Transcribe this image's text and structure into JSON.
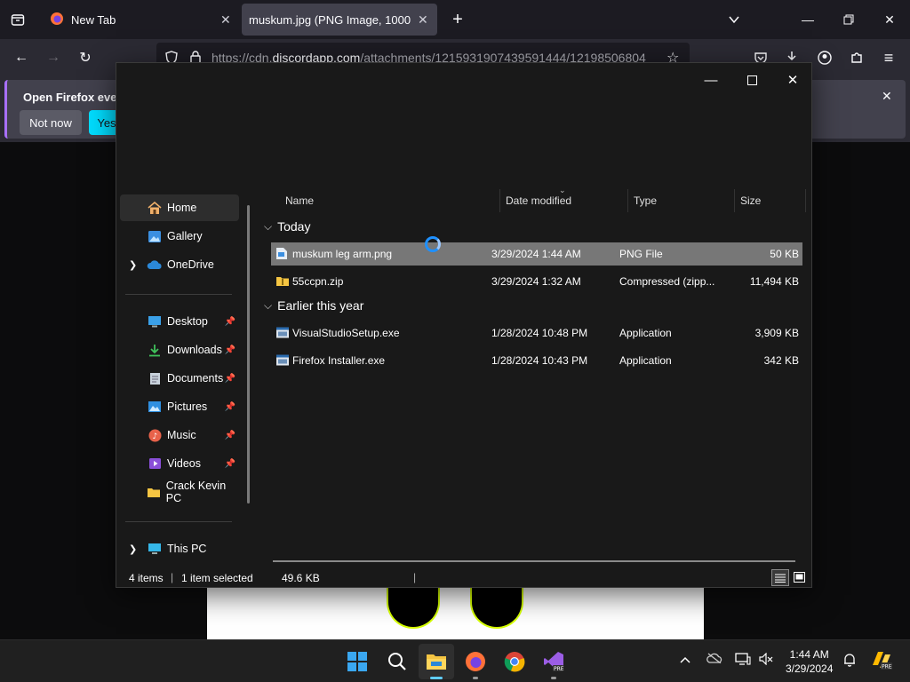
{
  "browser": {
    "tabs": [
      {
        "title": "New Tab",
        "active": false
      },
      {
        "title": "muskum.jpg (PNG Image, 1000 × 10",
        "active": true
      }
    ],
    "url_prefix": "https://cdn.",
    "url_domain": "discordapp.com",
    "url_rest": "/attachments/1215931907439591444/12198506804",
    "notification": {
      "title": "Open Firefox every",
      "not_now": "Not now",
      "yes": "Yes"
    }
  },
  "dialog": {
    "sidebar": {
      "items": [
        {
          "label": "Home",
          "icon": "home-icon",
          "selected": true
        },
        {
          "label": "Gallery",
          "icon": "gallery-icon"
        },
        {
          "label": "OneDrive",
          "icon": "onedrive-icon"
        },
        {
          "label": "Desktop",
          "icon": "desktop-icon",
          "pinned": true
        },
        {
          "label": "Downloads",
          "icon": "downloads-icon",
          "pinned": true
        },
        {
          "label": "Documents",
          "icon": "documents-icon",
          "pinned": true
        },
        {
          "label": "Pictures",
          "icon": "pictures-icon",
          "pinned": true
        },
        {
          "label": "Music",
          "icon": "music-icon",
          "pinned": true
        },
        {
          "label": "Videos",
          "icon": "videos-icon",
          "pinned": true
        },
        {
          "label": "Crack Kevin PC",
          "icon": "folder-icon"
        },
        {
          "label": "This PC",
          "icon": "this-pc-icon"
        }
      ]
    },
    "columns": {
      "name": "Name",
      "date": "Date modified",
      "type": "Type",
      "size": "Size"
    },
    "groups": [
      {
        "label": "Today",
        "files": [
          {
            "name": "muskum leg arm.png",
            "date": "3/29/2024 1:44 AM",
            "type": "PNG File",
            "size": "50 KB",
            "selected": true,
            "icon": "png-file-icon"
          },
          {
            "name": "55ccpn.zip",
            "date": "3/29/2024 1:32 AM",
            "type": "Compressed (zipp...",
            "size": "11,494 KB",
            "icon": "zip-folder-icon"
          }
        ]
      },
      {
        "label": "Earlier this year",
        "files": [
          {
            "name": "VisualStudioSetup.exe",
            "date": "1/28/2024 10:48 PM",
            "type": "Application",
            "size": "3,909 KB",
            "icon": "exe-file-icon"
          },
          {
            "name": "Firefox Installer.exe",
            "date": "1/28/2024 10:43 PM",
            "type": "Application",
            "size": "342 KB",
            "icon": "exe-file-icon"
          }
        ]
      }
    ],
    "status": {
      "count": "4 items",
      "selected": "1 item selected",
      "size": "49.6 KB"
    }
  },
  "taskbar": {
    "time": "1:44 AM",
    "date": "3/29/2024"
  },
  "colors": {
    "accent": "#0078d4",
    "selection": "#777777",
    "firefox_purple": "#a970ff"
  }
}
